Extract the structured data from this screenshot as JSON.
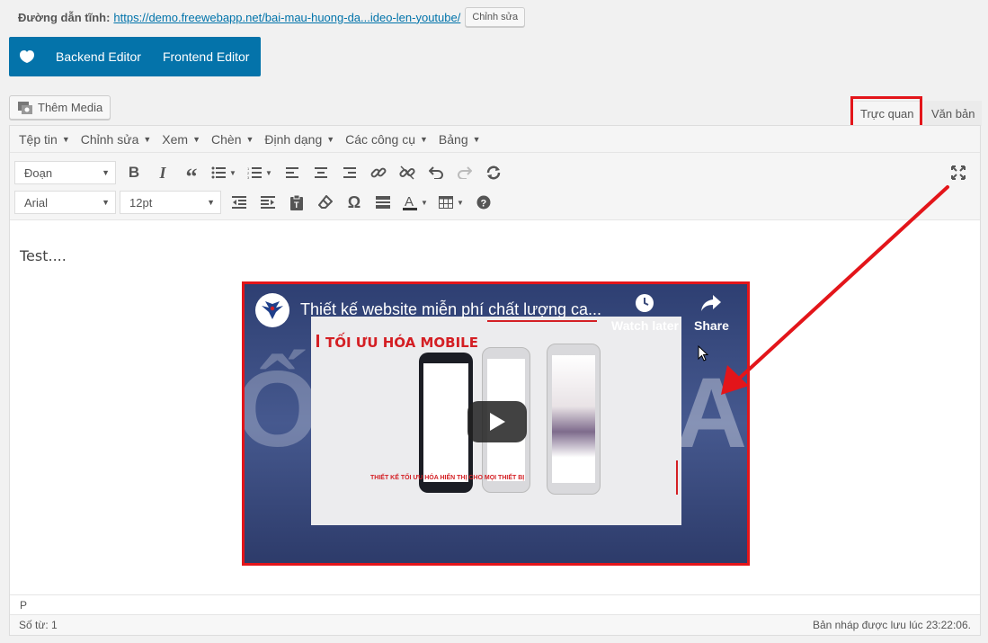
{
  "permalink": {
    "label": "Đường dẫn tĩnh:",
    "url": "https://demo.freewebapp.net/bai-mau-huong-da...ideo-len-youtube/",
    "edit_button": "Chỉnh sửa"
  },
  "builder": {
    "backend_label": "Backend Editor",
    "frontend_label": "Frontend Editor"
  },
  "media": {
    "add_label": "Thêm Media"
  },
  "tabs": {
    "visual": "Trực quan",
    "text": "Văn bản"
  },
  "menubar": {
    "items": [
      "Tệp tin",
      "Chỉnh sửa",
      "Xem",
      "Chèn",
      "Định dạng",
      "Các công cụ",
      "Bảng"
    ]
  },
  "toolbar": {
    "block_format": "Đoạn",
    "font_family": "Arial",
    "font_size": "12pt"
  },
  "content": {
    "text": "Test....",
    "video": {
      "title": "Thiết kế website miễn phí chất lượng ca...",
      "watch_later": "Watch later",
      "share": "Share",
      "brand_text": "TỐI ƯU HÓA MOBILE",
      "caption": "THIẾT KẾ TỐI ƯU HÓA HIỂN THỊ CHO MỌI THIẾT BỊ",
      "bg_letter_left": "Ố",
      "bg_letter_right": "A"
    }
  },
  "footer": {
    "path": "P",
    "word_count": "Số từ: 1",
    "draft_saved": "Bản nháp được lưu lúc 23:22:06."
  },
  "colors": {
    "accent": "#0473aa",
    "highlight": "#e3151a",
    "link": "#0073aa"
  }
}
